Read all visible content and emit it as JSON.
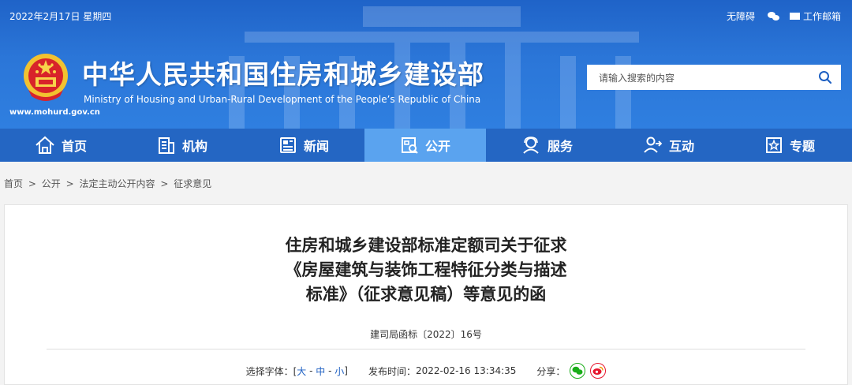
{
  "header": {
    "date": "2022年2月17日 星期四",
    "accessibility": "无障碍",
    "mail": "工作邮箱",
    "site_url": "www.mohurd.gov.cn",
    "title_cn": "中华人民共和国住房和城乡建设部",
    "title_en": "Ministry of Housing and Urban-Rural Development of the People’s Republic of China",
    "search_placeholder": "请输入搜索的内容"
  },
  "nav": {
    "items": [
      {
        "label": "首页",
        "icon": "home-icon"
      },
      {
        "label": "机构",
        "icon": "building-icon"
      },
      {
        "label": "新闻",
        "icon": "newspaper-icon"
      },
      {
        "label": "公开",
        "icon": "disclosure-icon",
        "active": true
      },
      {
        "label": "服务",
        "icon": "service-icon"
      },
      {
        "label": "互动",
        "icon": "interaction-icon"
      },
      {
        "label": "专题",
        "icon": "star-icon"
      }
    ]
  },
  "breadcrumb": [
    "首页",
    "公开",
    "法定主动公开内容",
    "征求意见"
  ],
  "breadcrumb_sep": ">",
  "article": {
    "title_lines": [
      "住房和城乡建设部标准定额司关于征求",
      "《房屋建筑与装饰工程特征分类与描述",
      "标准》（征求意见稿）等意见的函"
    ],
    "doc_number": "建司局函标〔2022〕16号",
    "font_label": "选择字体：[",
    "font_sizes": [
      "大",
      "中",
      "小"
    ],
    "font_close": "]",
    "publish_label": "发布时间：",
    "publish_time": "2022-02-16 13:34:35",
    "share_label": "分享："
  },
  "colors": {
    "header_blue": "#2b76d8",
    "nav_blue": "#2466c3",
    "nav_active": "#5aa3ef",
    "wechat_green": "#1aad19",
    "weibo_red": "#e6162d"
  }
}
